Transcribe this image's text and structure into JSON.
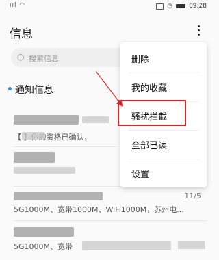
{
  "status_bar": {
    "time": "09:28"
  },
  "header": {
    "title": "信息"
  },
  "search": {
    "placeholder": "搜索信息"
  },
  "section": {
    "title": "通知信息"
  },
  "messages": [
    {
      "snippet": "【      】你的资格已确认，"
    },
    {
      "snippet": ""
    },
    {
      "date": "11/5",
      "snippet": "5G1000M、宽带1000M、WiFi1000M，苏州电..."
    },
    {
      "snippet": "5G1000M、宽带"
    }
  ],
  "menu": {
    "items": [
      {
        "label": "删除"
      },
      {
        "label": "我的收藏"
      },
      {
        "label": "骚扰拦截"
      },
      {
        "label": "全部已读"
      },
      {
        "label": "设置"
      }
    ]
  },
  "colors": {
    "accent": "#2d8be0",
    "highlight": "#d32a2a"
  }
}
